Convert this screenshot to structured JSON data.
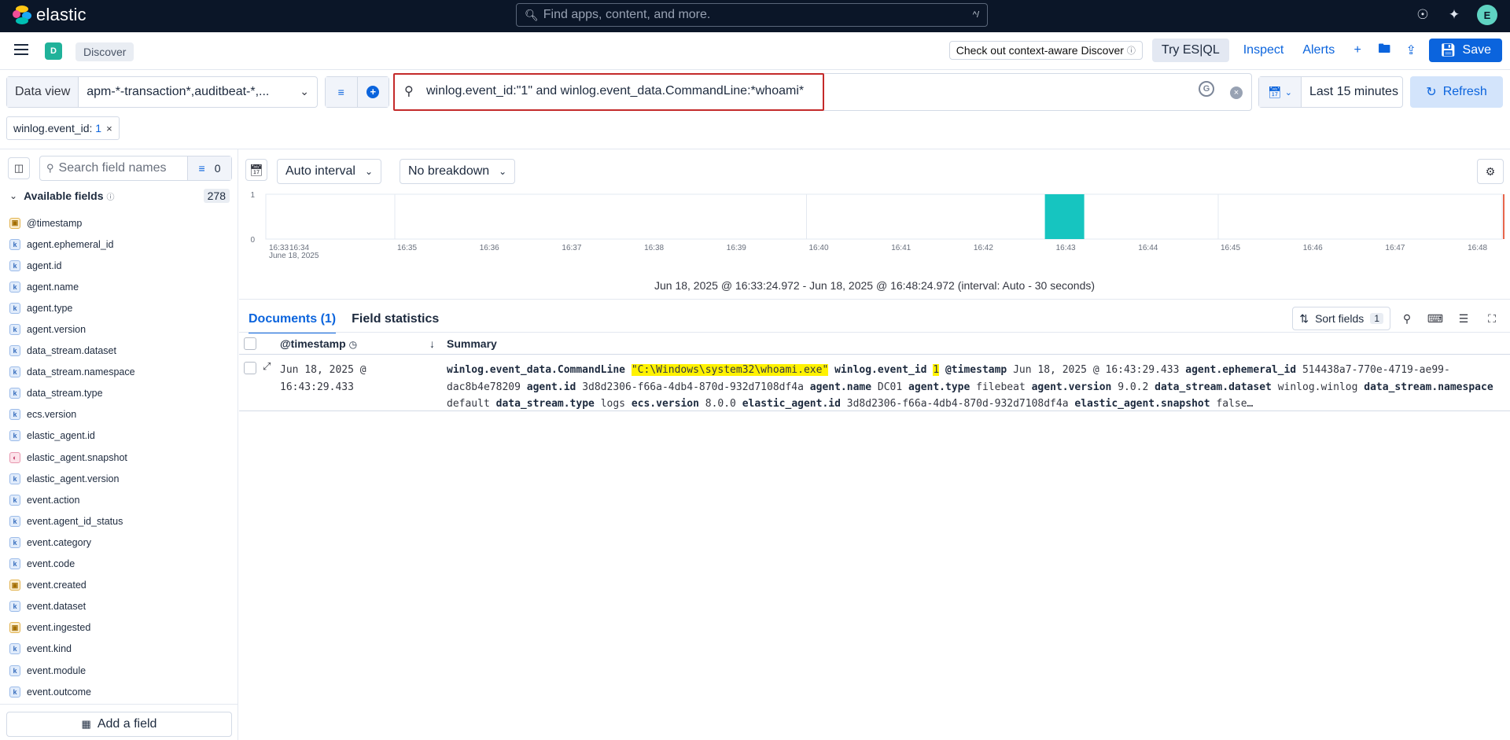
{
  "app": {
    "brand": "elastic",
    "global_search_placeholder": "Find apps, content, and more.",
    "global_search_shortcut": "^/",
    "avatar_initial": "E"
  },
  "breadcrumb": {
    "space_initial": "D",
    "current": "Discover"
  },
  "nav": {
    "context_aware": "Check out context-aware Discover",
    "try_esql": "Try ES|QL",
    "inspect": "Inspect",
    "alerts": "Alerts",
    "save": "Save"
  },
  "query": {
    "data_view_label": "Data view",
    "data_view_value": "apm-*-transaction*,auditbeat-*,...",
    "kql": "winlog.event_id:\"1\" and winlog.event_data.CommandLine:*whoami*",
    "time_range": "Last 15 minutes",
    "refresh": "Refresh"
  },
  "filter_pill": {
    "field": "winlog.event_id:",
    "value": "1"
  },
  "sidebar": {
    "search_placeholder": "Search field names",
    "filter_count": "0",
    "available_title": "Available fields",
    "available_count": "278",
    "fields": [
      {
        "name": "@timestamp",
        "type": "date"
      },
      {
        "name": "agent.ephemeral_id",
        "type": "keyword"
      },
      {
        "name": "agent.id",
        "type": "keyword"
      },
      {
        "name": "agent.name",
        "type": "keyword"
      },
      {
        "name": "agent.type",
        "type": "keyword"
      },
      {
        "name": "agent.version",
        "type": "keyword"
      },
      {
        "name": "data_stream.dataset",
        "type": "keyword"
      },
      {
        "name": "data_stream.namespace",
        "type": "keyword"
      },
      {
        "name": "data_stream.type",
        "type": "keyword"
      },
      {
        "name": "ecs.version",
        "type": "keyword"
      },
      {
        "name": "elastic_agent.id",
        "type": "keyword"
      },
      {
        "name": "elastic_agent.snapshot",
        "type": "boolean"
      },
      {
        "name": "elastic_agent.version",
        "type": "keyword"
      },
      {
        "name": "event.action",
        "type": "keyword"
      },
      {
        "name": "event.agent_id_status",
        "type": "keyword"
      },
      {
        "name": "event.category",
        "type": "keyword"
      },
      {
        "name": "event.code",
        "type": "keyword"
      },
      {
        "name": "event.created",
        "type": "date"
      },
      {
        "name": "event.dataset",
        "type": "keyword"
      },
      {
        "name": "event.ingested",
        "type": "date"
      },
      {
        "name": "event.kind",
        "type": "keyword"
      },
      {
        "name": "event.module",
        "type": "keyword"
      },
      {
        "name": "event.outcome",
        "type": "keyword"
      }
    ],
    "add_field": "Add a field"
  },
  "chart_toolbar": {
    "interval": "Auto interval",
    "breakdown": "No breakdown"
  },
  "chart_data": {
    "type": "bar",
    "categories": [
      "16:33",
      "16:34",
      "16:35",
      "16:36",
      "16:37",
      "16:38",
      "16:39",
      "16:40",
      "16:41",
      "16:42",
      "16:43",
      "16:44",
      "16:45",
      "16:46",
      "16:47",
      "16:48"
    ],
    "date_label": "June 18, 2025",
    "y_ticks": [
      "1",
      "0"
    ],
    "ylim": [
      0,
      1
    ],
    "bars": [
      {
        "x": "16:43",
        "value": 1
      }
    ],
    "bar_color": "#16c5c0",
    "now_marker_color": "#e7664c"
  },
  "histogram_range": "Jun 18, 2025 @ 16:33:24.972 - Jun 18, 2025 @ 16:48:24.972 (interval: Auto - 30 seconds)",
  "tabs": {
    "documents": "Documents (1)",
    "field_statistics": "Field statistics"
  },
  "doc_tools": {
    "sort_fields": "Sort fields",
    "sort_count": "1"
  },
  "grid": {
    "col_timestamp": "@timestamp",
    "col_summary": "Summary",
    "row": {
      "ts_line1": "Jun 18, 2025 @",
      "ts_line2": "16:43:29.433",
      "summary": [
        {
          "k": "winlog.event_data.CommandLine",
          "v": "\"C:\\Windows\\system32\\whoami.exe\"",
          "hl": true
        },
        {
          "k": "winlog.event_id",
          "v": "1",
          "hl": true
        },
        {
          "k": "@timestamp",
          "v": "Jun 18, 2025 @ 16:43:29.433"
        },
        {
          "k": "agent.ephemeral_id",
          "v": "514438a7-770e-4719-ae99-dac8b4e78209"
        },
        {
          "k": "agent.id",
          "v": "3d8d2306-f66a-4db4-870d-932d7108df4a"
        },
        {
          "k": "agent.name",
          "v": "DC01"
        },
        {
          "k": "agent.type",
          "v": "filebeat"
        },
        {
          "k": "agent.version",
          "v": "9.0.2"
        },
        {
          "k": "data_stream.dataset",
          "v": "winlog.winlog"
        },
        {
          "k": "data_stream.namespace",
          "v": "default"
        },
        {
          "k": "data_stream.type",
          "v": "logs"
        },
        {
          "k": "ecs.version",
          "v": "8.0.0"
        },
        {
          "k": "elastic_agent.id",
          "v": "3d8d2306-f66a-4db4-870d-932d7108df4a"
        },
        {
          "k": "elastic_agent.snapshot",
          "v": "false…"
        }
      ]
    }
  }
}
